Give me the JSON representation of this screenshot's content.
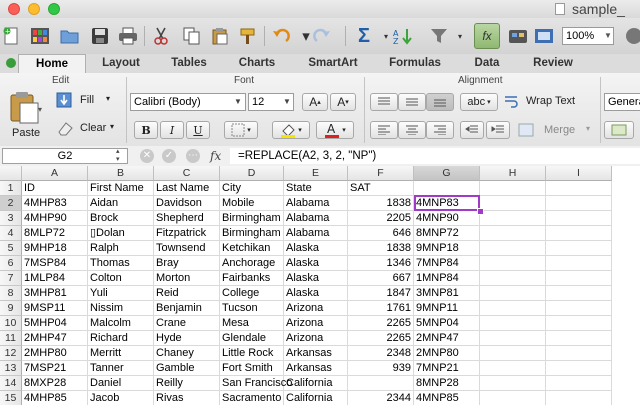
{
  "window": {
    "title": "sample_"
  },
  "toolbar": {
    "zoom": "100%"
  },
  "tabs": [
    "Home",
    "Layout",
    "Tables",
    "Charts",
    "SmartArt",
    "Formulas",
    "Data",
    "Review"
  ],
  "ribbon": {
    "edit_group": "Edit",
    "font_group": "Font",
    "alignment_group": "Alignment",
    "paste": "Paste",
    "fill": "Fill",
    "clear": "Clear",
    "font_name": "Calibri (Body)",
    "font_size": "12",
    "bold": "B",
    "italic": "I",
    "underline": "U",
    "wrap_text": "Wrap Text",
    "merge": "Merge",
    "abc": "abc",
    "number_format": "Genera"
  },
  "formula_bar": {
    "name_box": "G2",
    "fx": "fx",
    "formula": "=REPLACE(A2, 3, 2, \"NP\")"
  },
  "grid": {
    "columns": [
      "A",
      "B",
      "C",
      "D",
      "E",
      "F",
      "G",
      "H",
      "I"
    ],
    "rows": [
      [
        "ID",
        "First Name",
        "Last Name",
        "City",
        "State",
        "SAT",
        "",
        "",
        ""
      ],
      [
        "4MHP83",
        "Aidan",
        "Davidson",
        "Mobile",
        "Alabama",
        "1838",
        "4MNP83",
        "",
        ""
      ],
      [
        "4MHP90",
        " Brock",
        "Shepherd",
        "Birmingham",
        "Alabama",
        "2205",
        "4MNP90",
        "",
        ""
      ],
      [
        "8MLP72",
        "▯Dolan",
        "Fitzpatrick",
        "Birmingham",
        "Alabama",
        "646",
        "8MNP72",
        "",
        ""
      ],
      [
        "9MHP18",
        "Ralph",
        "Townsend",
        "Ketchikan",
        "Alaska",
        "1838",
        "9MNP18",
        "",
        ""
      ],
      [
        "7MSP84",
        "Thomas",
        "Bray",
        "Anchorage",
        "Alaska",
        "1346",
        "7MNP84",
        "",
        ""
      ],
      [
        "1MLP84",
        "Colton",
        "Morton",
        "Fairbanks",
        "Alaska",
        "667",
        "1MNP84",
        "",
        ""
      ],
      [
        "3MHP81",
        "Yuli",
        "Reid",
        "College",
        "Alaska",
        "1847",
        "3MNP81",
        "",
        ""
      ],
      [
        "9MSP11",
        "Nissim",
        "Benjamin",
        "Tucson",
        "Arizona",
        "1761",
        "9MNP11",
        "",
        ""
      ],
      [
        "5MHP04",
        "Malcolm",
        "Crane",
        "Mesa",
        "Arizona",
        "2265",
        "5MNP04",
        "",
        ""
      ],
      [
        "2MHP47",
        "Richard",
        "Hyde",
        "Glendale",
        "Arizona",
        "2265",
        "2MNP47",
        "",
        ""
      ],
      [
        "2MHP80",
        "Merritt",
        "Chaney",
        "Little Rock",
        "Arkansas",
        "2348",
        "2MNP80",
        "",
        ""
      ],
      [
        "7MSP21",
        "Tanner",
        "Gamble",
        "Fort Smith",
        "Arkansas",
        "939",
        "7MNP21",
        "",
        ""
      ],
      [
        "8MXP28",
        "Daniel",
        "Reilly",
        "San Francisco",
        "California",
        "",
        "8MNP28",
        "",
        ""
      ],
      [
        "4MHP85",
        "Jacob",
        "Rivas",
        "Sacramento",
        "California",
        "2344",
        "4MNP85",
        "",
        ""
      ]
    ]
  }
}
